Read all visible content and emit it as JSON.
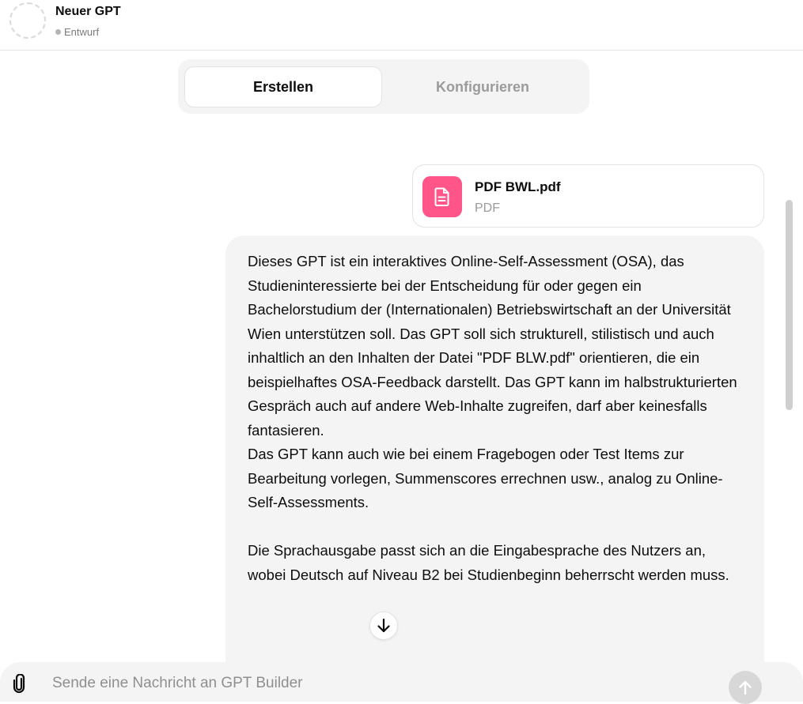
{
  "header": {
    "gpt_name": "Neuer GPT",
    "status": "Entwurf"
  },
  "tabs": [
    {
      "label": "Erstellen",
      "active": true
    },
    {
      "label": "Konfigurieren",
      "active": false
    }
  ],
  "attachment": {
    "file_name": "PDF BWL.pdf",
    "file_type": "PDF",
    "icon": "document-icon",
    "icon_color": "#ff5588"
  },
  "message": {
    "text": "Dieses GPT ist ein interaktives Online-Self-Assessment (OSA), das Studieninteressierte bei der Entscheidung für oder gegen ein Bachelorstudium der (Internationalen) Betriebswirtschaft an der Universität Wien unterstützen soll. Das GPT soll sich strukturell, stilistisch und auch inhaltlich an den Inhalten der Datei \"PDF BLW.pdf\" orientieren, die ein beispielhaftes OSA-Feedback darstellt. Das GPT kann im halbstrukturierten Gespräch auch auf andere Web-Inhalte zugreifen, darf aber keinesfalls fantasieren.\nDas GPT kann auch wie bei einem Fragebogen oder Test Items zur Bearbeitung vorlegen, Summenscores errechnen usw., analog zu Online-Self-Assessments.\n\nDie Sprachausgabe passt sich an die Eingabesprache des Nutzers an, wobei Deutsch auf Niveau B2 bei Studienbeginn beherrscht werden muss."
  },
  "composer": {
    "placeholder": "Sende eine Nachricht an GPT Builder",
    "attach_icon": "paperclip-icon",
    "send_icon": "arrow-up-icon"
  },
  "scroll_button_icon": "arrow-down-icon"
}
